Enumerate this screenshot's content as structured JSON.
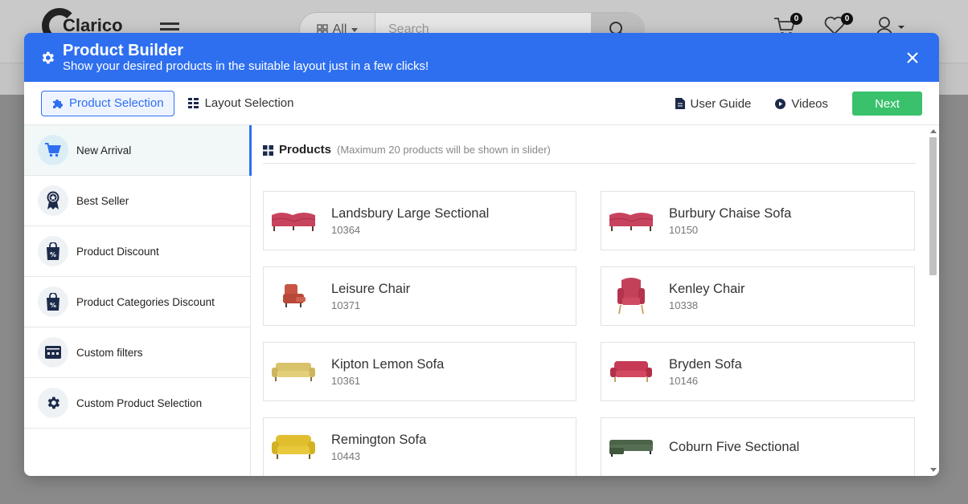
{
  "site": {
    "logo_text": "Clarico",
    "search_category": "All",
    "search_placeholder": "Search",
    "cart_count": "0",
    "wishlist_count": "0"
  },
  "modal": {
    "title": "Product Builder",
    "subtitle": "Show your desired products in the suitable layout just in a few clicks!",
    "tabs": [
      {
        "label": "Product Selection",
        "icon": "puzzle-icon",
        "active": true
      },
      {
        "label": "Layout Selection",
        "icon": "grid-icon",
        "active": false
      }
    ],
    "user_guide_label": "User Guide",
    "videos_label": "Videos",
    "next_label": "Next"
  },
  "sidebar": {
    "items": [
      {
        "label": "New Arrival",
        "icon": "cart-icon",
        "active": true
      },
      {
        "label": "Best Seller",
        "icon": "award-ribbon-icon",
        "active": false
      },
      {
        "label": "Product Discount",
        "icon": "discount-bag-icon",
        "active": false
      },
      {
        "label": "Product Categories Discount",
        "icon": "discount-bag-icon",
        "active": false
      },
      {
        "label": "Custom filters",
        "icon": "filter-panel-icon",
        "active": false
      },
      {
        "label": "Custom Product Selection",
        "icon": "gear-icon",
        "active": false
      }
    ]
  },
  "products": {
    "title": "Products",
    "note": "(Maximum 20 products will be shown in slider)",
    "items": [
      {
        "name": "Landsbury Large Sectional",
        "code": "10364",
        "image": "sectional-sofa",
        "color": "#c8435e"
      },
      {
        "name": "Burbury Chaise Sofa",
        "code": "10150",
        "image": "sectional-sofa",
        "color": "#c8435e"
      },
      {
        "name": "Leisure Chair",
        "code": "10371",
        "image": "recliner-chair",
        "color": "#c85444"
      },
      {
        "name": "Kenley Chair",
        "code": "10338",
        "image": "armchair",
        "color": "#c4415a"
      },
      {
        "name": "Kipton Lemon Sofa",
        "code": "10361",
        "image": "sofa",
        "color": "#d9c36a"
      },
      {
        "name": "Bryden Sofa",
        "code": "10146",
        "image": "sofa",
        "color": "#c63a55"
      },
      {
        "name": "Remington Sofa",
        "code": "10443",
        "image": "sofa",
        "color": "#e0be2e"
      },
      {
        "name": "Coburn Five Sectional",
        "code": "",
        "image": "sectional-sofa",
        "color": "#4a6448"
      }
    ]
  },
  "colors": {
    "primary": "#2e6ff0",
    "success": "#39c16c",
    "icon_dark": "#1c2a4a"
  }
}
